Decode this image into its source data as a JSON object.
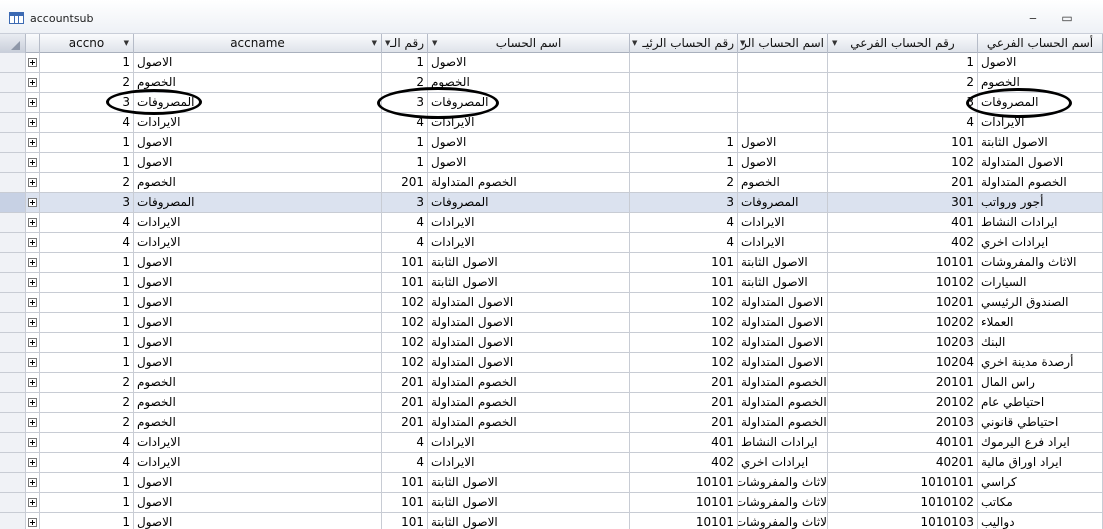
{
  "window": {
    "title": "accountsub",
    "minimize_glyph": "‒",
    "maximize_glyph": "▭",
    "icons": [
      "table-icon",
      "minimize-icon",
      "maximize-icon"
    ]
  },
  "columns": [
    {
      "key": "accno",
      "label": "accno"
    },
    {
      "key": "accname",
      "label": "accname"
    },
    {
      "key": "c3",
      "label": "رقم الـ"
    },
    {
      "key": "c4",
      "label": "اسم الحساب"
    },
    {
      "key": "c5",
      "label": "رقم الحساب الرئيـ"
    },
    {
      "key": "c6",
      "label": "اسم الحساب الر"
    },
    {
      "key": "c7",
      "label": "رقم الحساب الفرعي"
    },
    {
      "key": "c8",
      "label": "أسم الحساب الفرعي"
    }
  ],
  "rows": [
    [
      "1",
      "الاصول",
      "1",
      "الاصول",
      "",
      "",
      "1",
      "الاصول"
    ],
    [
      "2",
      "الخصوم",
      "2",
      "الخصوم",
      "",
      "",
      "2",
      "الخصوم"
    ],
    [
      "3",
      "المصروفات",
      "3",
      "المصروفات",
      "",
      "",
      "3",
      "المصروفات"
    ],
    [
      "4",
      "الايرادات",
      "4",
      "الايرادات",
      "",
      "",
      "4",
      "الايرادات"
    ],
    [
      "1",
      "الاصول",
      "1",
      "الاصول",
      "1",
      "الاصول",
      "101",
      "الاصول الثابتة"
    ],
    [
      "1",
      "الاصول",
      "1",
      "الاصول",
      "1",
      "الاصول",
      "102",
      "الاصول المتداولة"
    ],
    [
      "2",
      "الخصوم",
      "201",
      "الخصوم المتداولة",
      "2",
      "الخصوم",
      "201",
      "الخصوم المتداولة"
    ],
    [
      "3",
      "المصروفات",
      "3",
      "المصروفات",
      "3",
      "المصروفات",
      "301",
      "أجور ورواتب"
    ],
    [
      "4",
      "الايرادات",
      "4",
      "الايرادات",
      "4",
      "الايرادات",
      "401",
      "ايرادات النشاط"
    ],
    [
      "4",
      "الايرادات",
      "4",
      "الايرادات",
      "4",
      "الايرادات",
      "402",
      "ايرادات اخري"
    ],
    [
      "1",
      "الاصول",
      "101",
      "الاصول الثابتة",
      "101",
      "الاصول الثابتة",
      "10101",
      "الاثاث والمفروشات"
    ],
    [
      "1",
      "الاصول",
      "101",
      "الاصول الثابتة",
      "101",
      "الاصول الثابتة",
      "10102",
      "السيارات"
    ],
    [
      "1",
      "الاصول",
      "102",
      "الاصول المتداولة",
      "102",
      "الاصول المتداولة",
      "10201",
      "الصندوق الرئيسي"
    ],
    [
      "1",
      "الاصول",
      "102",
      "الاصول المتداولة",
      "102",
      "الاصول المتداولة",
      "10202",
      "العملاء"
    ],
    [
      "1",
      "الاصول",
      "102",
      "الاصول المتداولة",
      "102",
      "الاصول المتداولة",
      "10203",
      "البنك"
    ],
    [
      "1",
      "الاصول",
      "102",
      "الاصول المتداولة",
      "102",
      "الاصول المتداولة",
      "10204",
      "أرصدة مدينة اخري"
    ],
    [
      "2",
      "الخصوم",
      "201",
      "الخصوم المتداولة",
      "201",
      "الخصوم المتداولة",
      "20101",
      "راس المال"
    ],
    [
      "2",
      "الخصوم",
      "201",
      "الخصوم المتداولة",
      "201",
      "الخصوم المتداولة",
      "20102",
      "احتياطي عام"
    ],
    [
      "2",
      "الخصوم",
      "201",
      "الخصوم المتداولة",
      "201",
      "الخصوم المتداولة",
      "20103",
      "احتياطي قانوني"
    ],
    [
      "4",
      "الايرادات",
      "4",
      "الايرادات",
      "401",
      "ايرادات النشاط",
      "40101",
      "ايراد فرع اليرموك"
    ],
    [
      "4",
      "الايرادات",
      "4",
      "الايرادات",
      "402",
      "ايرادات اخري",
      "40201",
      "ايراد اوراق مالية"
    ],
    [
      "1",
      "الاصول",
      "101",
      "الاصول الثابتة",
      "10101",
      "لاثاث والمفروشات",
      "1010101",
      "كراسي"
    ],
    [
      "1",
      "الاصول",
      "101",
      "الاصول الثابتة",
      "10101",
      "لاثاث والمفروشات",
      "1010102",
      "مكاتب"
    ],
    [
      "1",
      "الاصول",
      "101",
      "الاصول الثابتة",
      "10101",
      "لاثاث والمفروشات",
      "1010103",
      "دواليب"
    ]
  ],
  "selected_row_index": 7
}
